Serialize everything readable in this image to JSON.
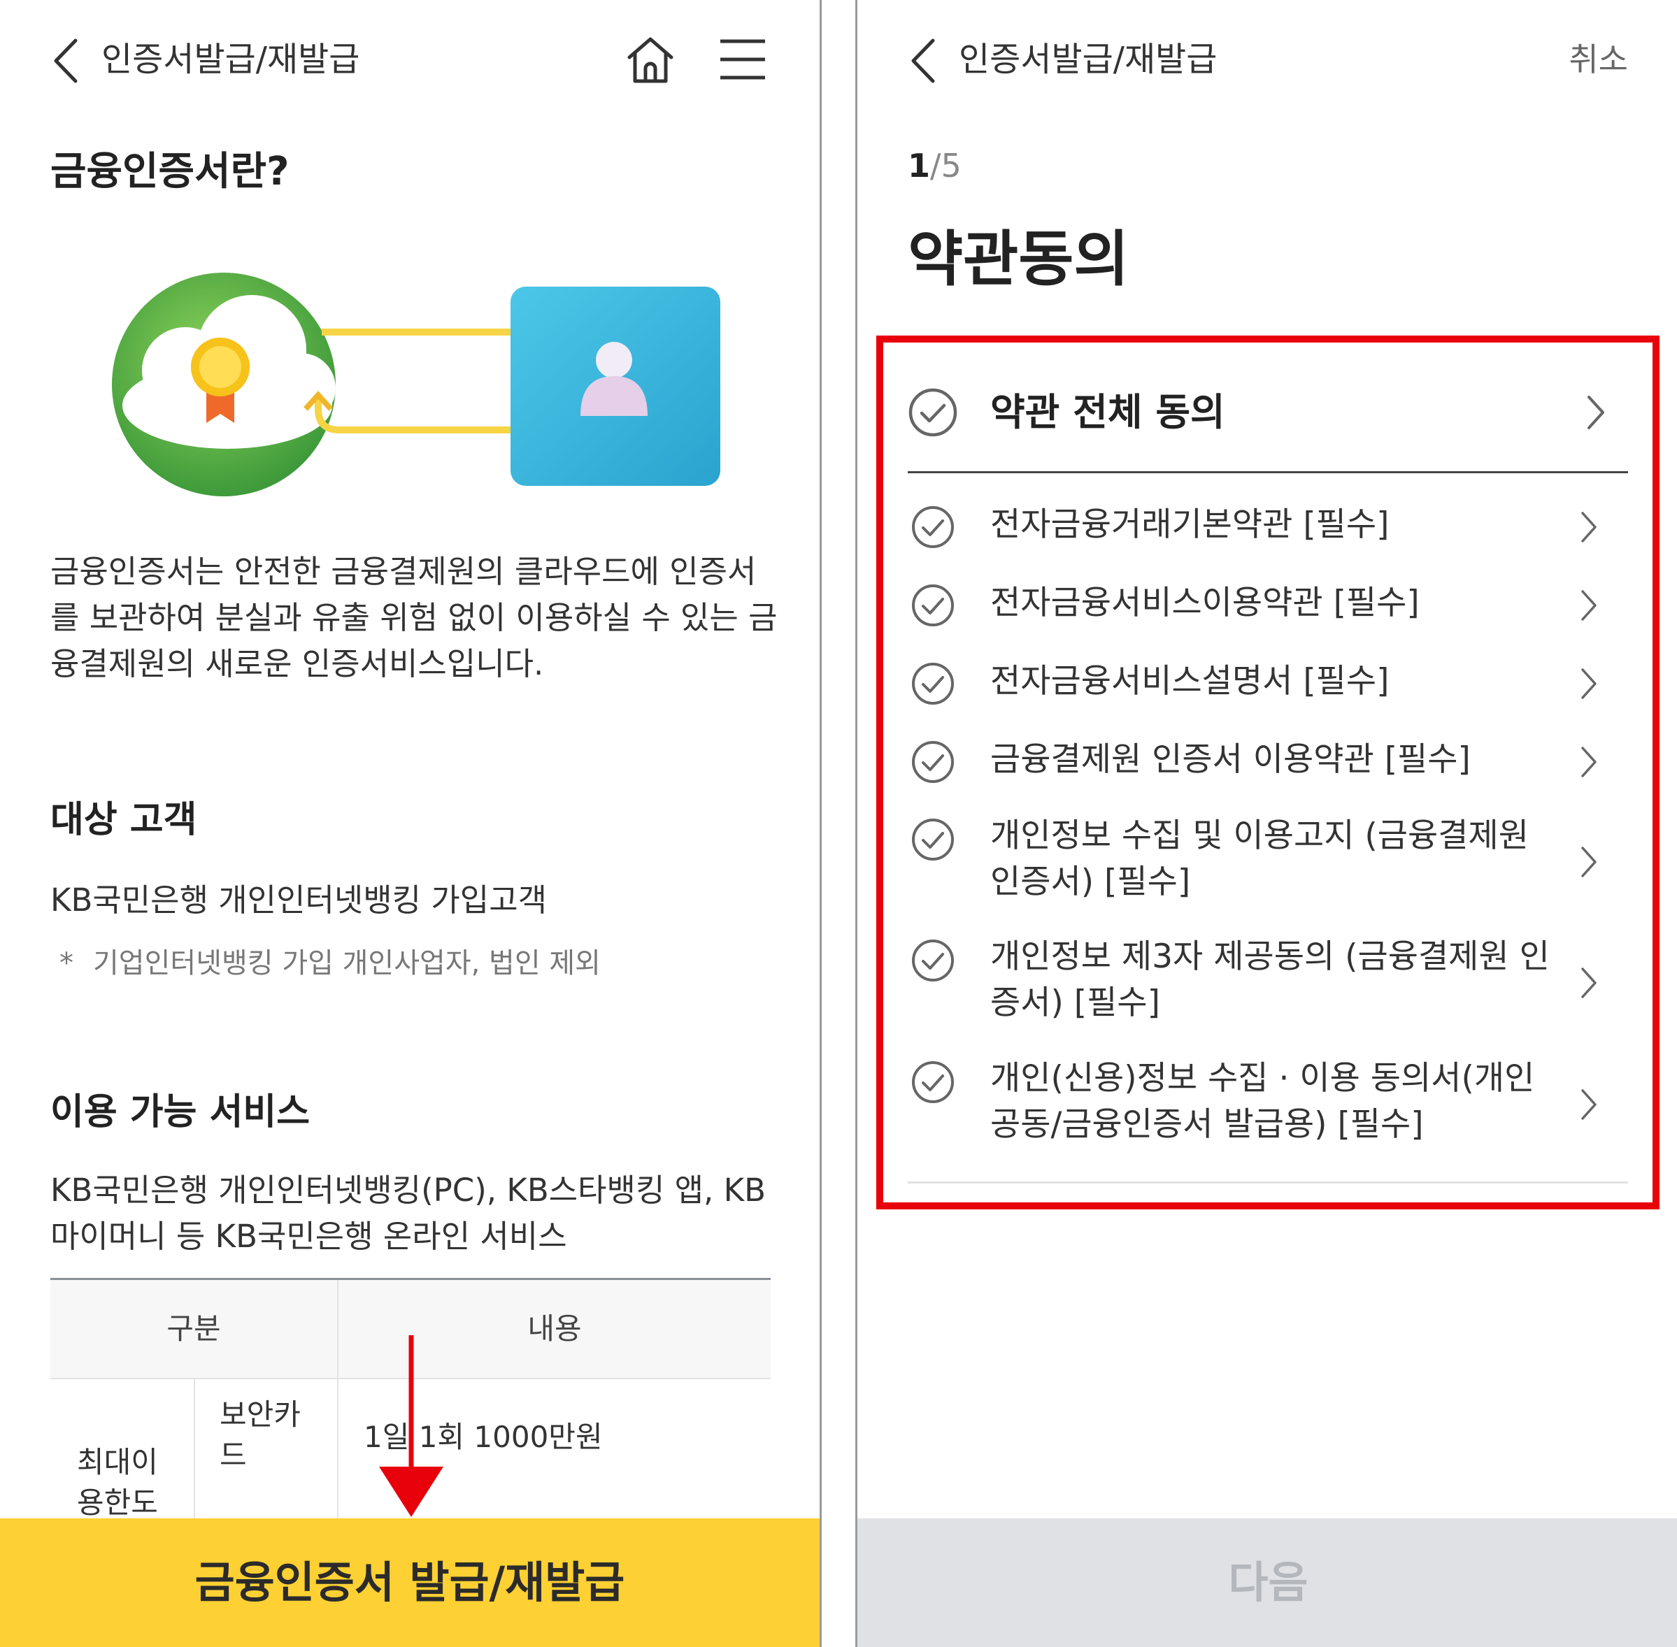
{
  "left": {
    "header": {
      "title": "인증서발급/재발급"
    },
    "page_title": "금융인증서란?",
    "description": "금융인증서는 안전한 금융결제원의 클라우드에 인증서를 보관하여 분실과 유출 위험 없이 이용하실 수 있는 금융결제원의 새로운 인증서비스입니다.",
    "target": {
      "heading": "대상 고객",
      "text": "KB국민은행 개인인터넷뱅킹 가입고객",
      "note_mark": "*",
      "note": "기업인터넷뱅킹 가입 개인사업자, 법인 제외"
    },
    "services": {
      "heading": "이용 가능 서비스",
      "text": "KB국민은행 개인인터넷뱅킹(PC), KB스타뱅킹 앱, KB 마이머니 등 KB국민은행 온라인 서비스"
    },
    "table": {
      "headers": [
        "구분",
        "내용"
      ],
      "row_group": "최대이용한도",
      "row_sub": "보안카드",
      "row_value": "1일 1회 1000만원"
    },
    "bottom_button": "금융인증서 발급/재발급"
  },
  "right": {
    "header": {
      "title": "인증서발급/재발급",
      "cancel": "취소"
    },
    "step": {
      "current": "1",
      "sep": "/",
      "total": "5"
    },
    "page_title": "약관동의",
    "agree_all": "약관 전체 동의",
    "terms": [
      "전자금융거래기본약관 [필수]",
      "전자금융서비스이용약관 [필수]",
      "전자금융서비스설명서 [필수]",
      "금융결제원 인증서 이용약관 [필수]",
      "개인정보 수집 및 이용고지 (금융결제원 인증서) [필수]",
      "개인정보 제3자 제공동의 (금융결제원 인증서) [필수]",
      "개인(신용)정보 수집 · 이용 동의서(개인 공동/금융인증서 발급용) [필수]"
    ],
    "next_button": "다음"
  },
  "colors": {
    "accent_yellow": "#fdd033",
    "highlight_red": "#e8000b",
    "disabled_gray": "#dfe1e4",
    "green_circle": "#6cc04a",
    "teal_card": "#3fb3d9"
  }
}
